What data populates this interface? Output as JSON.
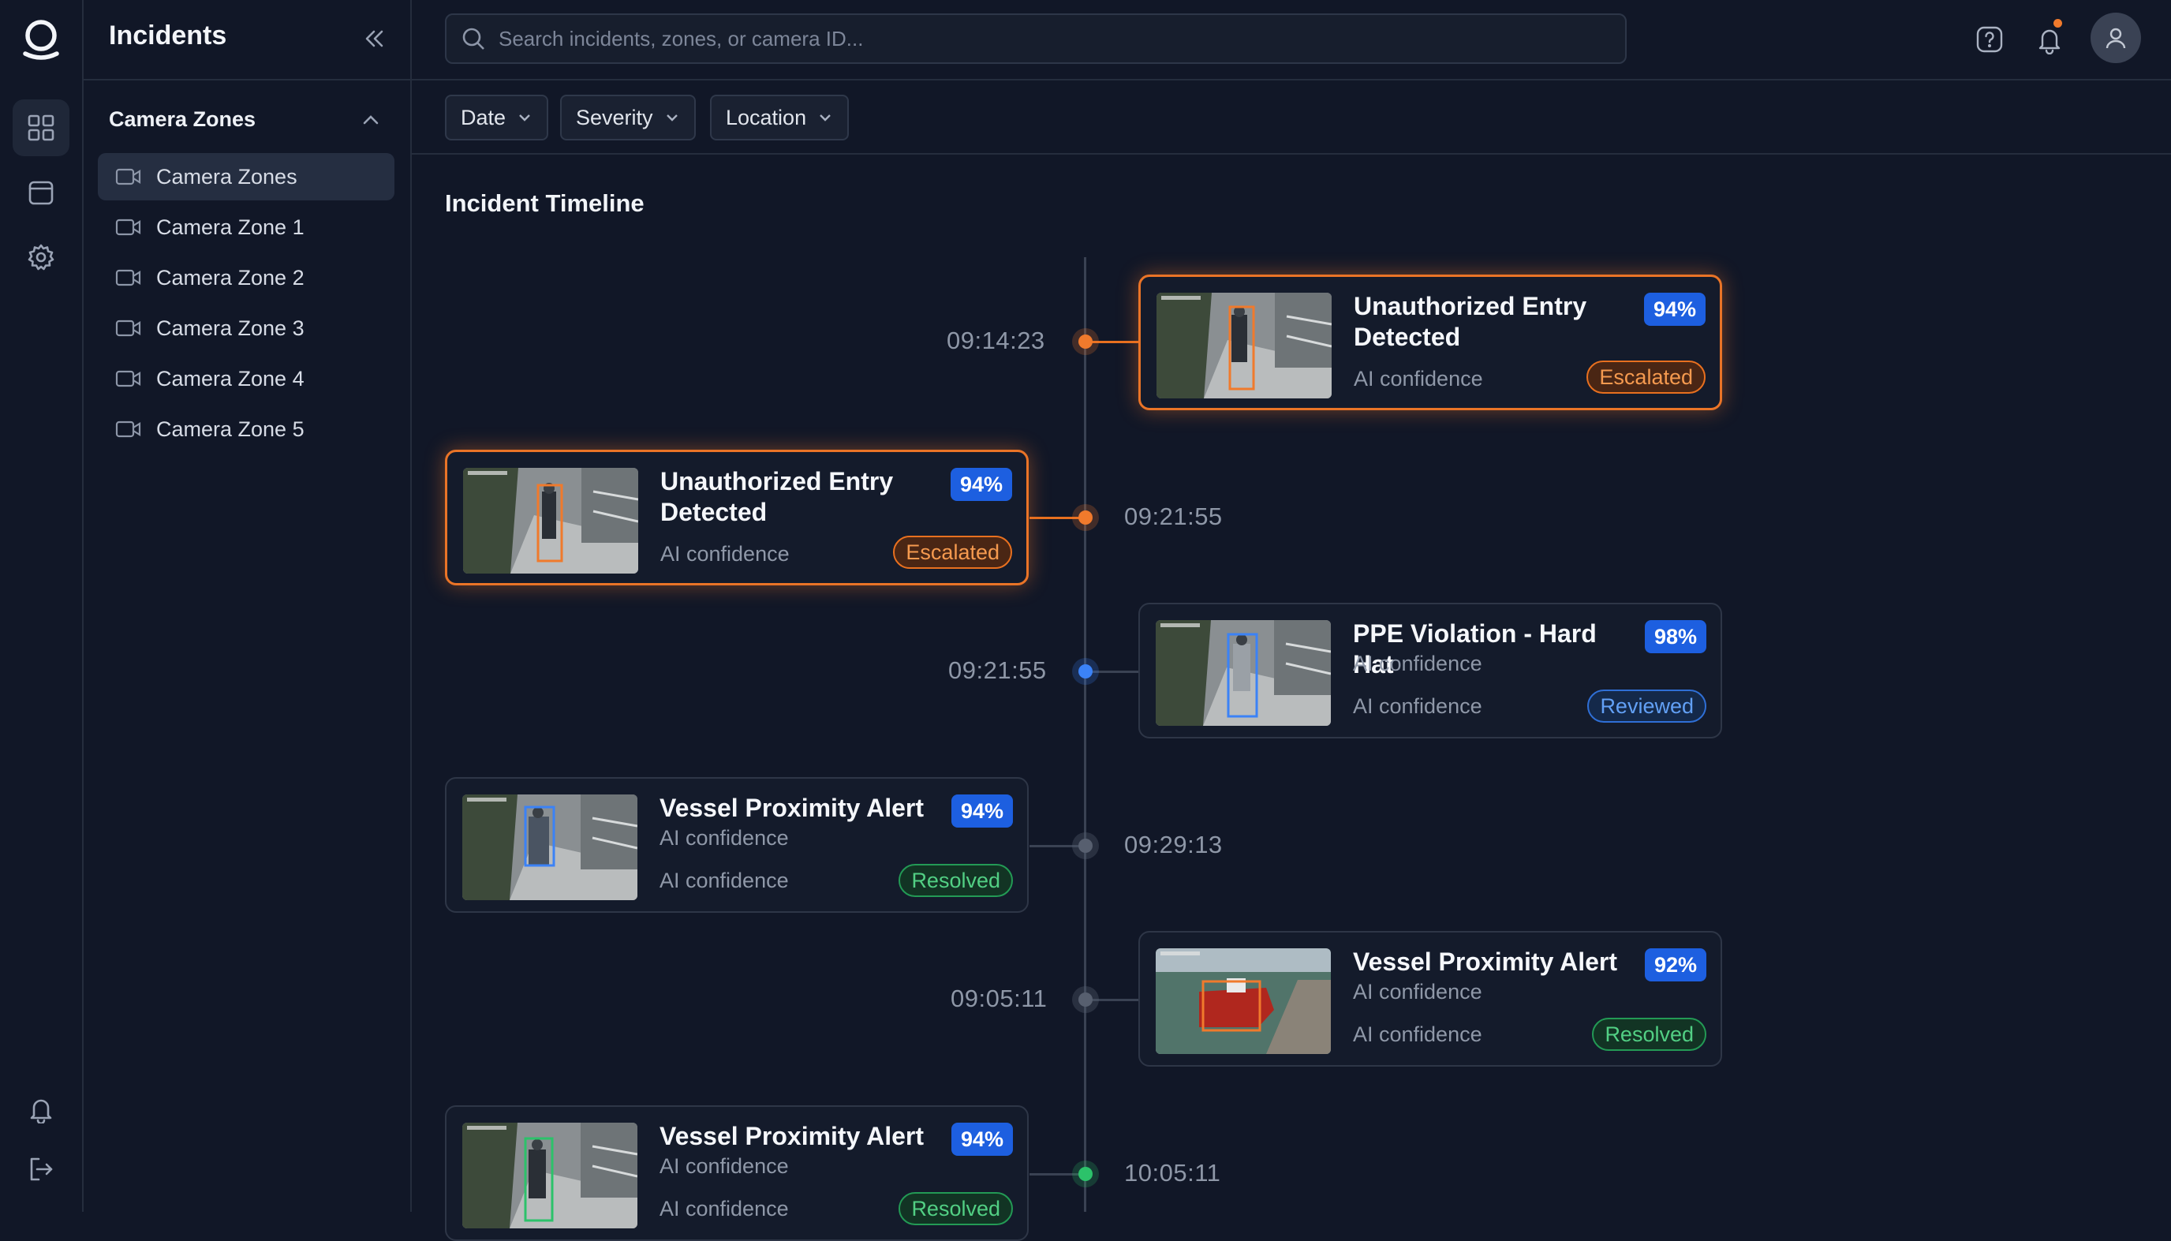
{
  "sidebar": {
    "title": "Incidents",
    "section_title": "Camera Zones",
    "items": [
      {
        "label": "Camera Zones"
      },
      {
        "label": "Camera Zone 1"
      },
      {
        "label": "Camera Zone 2"
      },
      {
        "label": "Camera Zone 3"
      },
      {
        "label": "Camera Zone 4"
      },
      {
        "label": "Camera Zone 5"
      }
    ]
  },
  "topbar": {
    "search_placeholder": "Search incidents, zones, or camera ID..."
  },
  "filters": [
    {
      "label": "Date"
    },
    {
      "label": "Severity"
    },
    {
      "label": "Location"
    }
  ],
  "timeline": {
    "title": "Incident Timeline",
    "events": [
      {
        "time": "09:14:23",
        "title": "Unauthorized Entry Detected",
        "confidence": "94%",
        "subtitle": "AI confidence",
        "status": "Escalated",
        "dot": "orange"
      },
      {
        "time": "09:21:55",
        "title": "Unauthorized Entry Detected",
        "confidence": "94%",
        "subtitle": "AI confidence",
        "status": "Escalated",
        "dot": "orange"
      },
      {
        "time": "09:21:55",
        "title": "PPE Violation - Hard Hat",
        "confidence": "98%",
        "subtitle": "AI confidence",
        "subtitle2": "AI confidence",
        "status": "Reviewed",
        "dot": "blue"
      },
      {
        "time": "09:29:13",
        "title": "Vessel Proximity Alert",
        "confidence": "94%",
        "subtitle": "AI confidence",
        "subtitle2": "AI confidence",
        "status": "Resolved",
        "dot": "gray"
      },
      {
        "time": "09:05:11",
        "title": "Vessel Proximity Alert",
        "confidence": "92%",
        "subtitle": "AI confidence",
        "subtitle2": "AI confidence",
        "status": "Resolved",
        "dot": "gray"
      },
      {
        "time": "10:05:11",
        "title": "Vessel Proximity Alert",
        "confidence": "94%",
        "subtitle": "AI confidence",
        "subtitle2": "AI confidence",
        "status": "Resolved",
        "dot": "green"
      }
    ]
  },
  "colors": {
    "background": "#111727",
    "accent_orange": "#f07a2c",
    "accent_blue": "#1d5fe0",
    "resolved_green": "#2cc26a"
  },
  "icons": [
    "logo-icon",
    "dashboard-icon",
    "calendar-icon",
    "settings-icon",
    "bell-icon",
    "logout-icon",
    "collapse-icon",
    "search-icon",
    "help-icon",
    "notification-icon",
    "user-icon",
    "camera-icon",
    "chevron-down-icon",
    "chevron-up-icon"
  ]
}
